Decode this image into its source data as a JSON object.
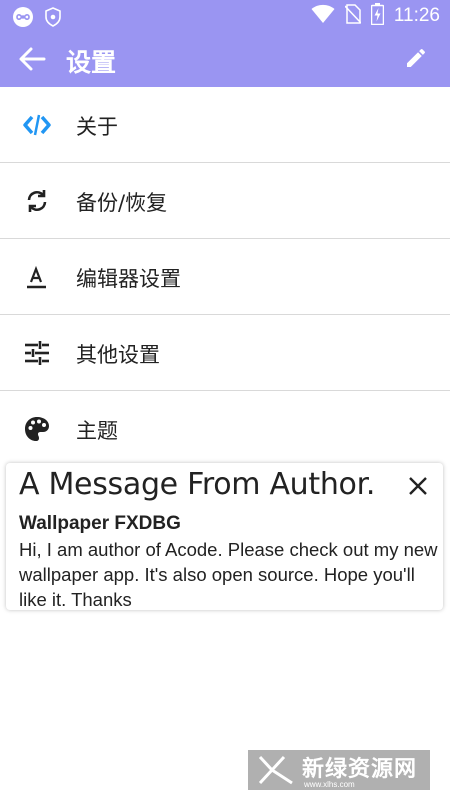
{
  "status_bar": {
    "time": "11:26",
    "icons": [
      "infinity-app-icon",
      "shield-icon",
      "wifi-icon",
      "no-sim-icon",
      "battery-charging-icon"
    ]
  },
  "appbar": {
    "title": "设置",
    "background": "#9a95f2"
  },
  "menu": {
    "items": [
      {
        "label": "关于",
        "icon": "code-icon"
      },
      {
        "label": "备份/恢复",
        "icon": "sync-icon"
      },
      {
        "label": "编辑器设置",
        "icon": "text-format-icon"
      },
      {
        "label": "其他设置",
        "icon": "sliders-icon"
      },
      {
        "label": "主题",
        "icon": "palette-icon"
      }
    ]
  },
  "message_card": {
    "title": "A Message From Author.",
    "subtitle": "Wallpaper FXDBG",
    "body": "Hi, I am author of Acode. Please check out my new wallpaper app. It's also open source. Hope you'll like it. Thanks"
  },
  "watermark": {
    "text": "新绿资源网",
    "url_text": "www.xlhs.com"
  }
}
